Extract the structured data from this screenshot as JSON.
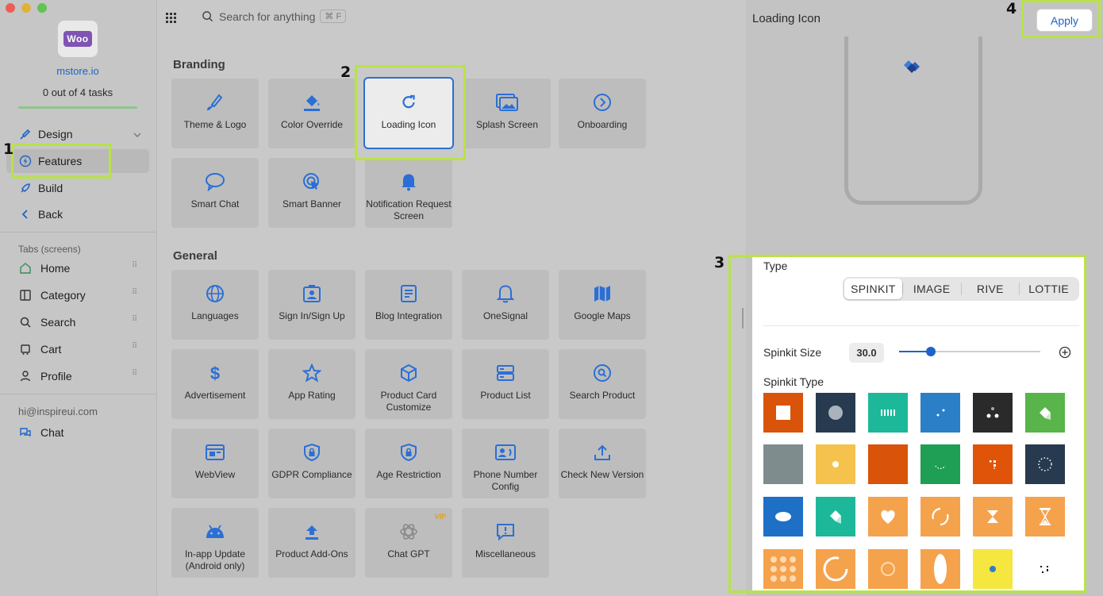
{
  "sidebar": {
    "store_name": "mstore.io",
    "tasks": "0 out of 4 tasks",
    "progress_fraction": 0,
    "logo_text": "Woo",
    "nav": {
      "design": "Design",
      "features": "Features",
      "build": "Build",
      "back": "Back"
    },
    "tabs_label": "Tabs (screens)",
    "tabs": [
      "Home",
      "Category",
      "Search",
      "Cart",
      "Profile"
    ],
    "email": "hi@inspireui.com",
    "chat": "Chat"
  },
  "topbar": {
    "search_placeholder": "Search for anything",
    "shortcut": "⌘ F"
  },
  "main": {
    "branding_title": "Branding",
    "branding": [
      "Theme & Logo",
      "Color Override",
      "Loading Icon",
      "Splash Screen",
      "Onboarding",
      "Smart Chat",
      "Smart Banner",
      "Notification Request Screen"
    ],
    "general_title": "General",
    "general": [
      "Languages",
      "Sign In/Sign Up",
      "Blog Integration",
      "OneSignal",
      "Google Maps",
      "Advertisement",
      "App Rating",
      "Product Card Customize",
      "Product List",
      "Search Product",
      "WebView",
      "GDPR Compliance",
      "Age Restriction",
      "Phone Number Config",
      "Check New Version",
      "In-app Update (Android only)",
      "Product Add-Ons",
      "Chat GPT",
      "Miscellaneous"
    ],
    "vip": "VIP"
  },
  "panel": {
    "title": "Loading Icon",
    "apply": "Apply",
    "type_label": "Type",
    "types": [
      "SPINKIT",
      "IMAGE",
      "RIVE",
      "LOTTIE"
    ],
    "selected_type": "SPINKIT",
    "size_label": "Spinkit Size",
    "size_value": "30.0",
    "size_slider_fraction": 0.22,
    "spinkit_type_label": "Spinkit Type"
  },
  "annotations": [
    "1",
    "2",
    "3",
    "4"
  ],
  "colors": {
    "accent": "#1e63c7",
    "highlight": "#b8e346",
    "swatches": [
      "#d9530a",
      "#283a4f",
      "#1db89a",
      "#2a7fc7",
      "#2a2a2a",
      "#59b449",
      "#7f8c8d",
      "#f5c24d",
      "#d9530a",
      "#1f9e55",
      "#e0540a",
      "#283a4f",
      "#1e6fc6",
      "#1db89a",
      "#f5a24d",
      "#f5a24d",
      "#f5a24d",
      "#f5a24d",
      "#f5a24d",
      "#f5a24d",
      "#f5a24d",
      "#f5a24d",
      "#f5e640",
      "#ffffff"
    ]
  }
}
